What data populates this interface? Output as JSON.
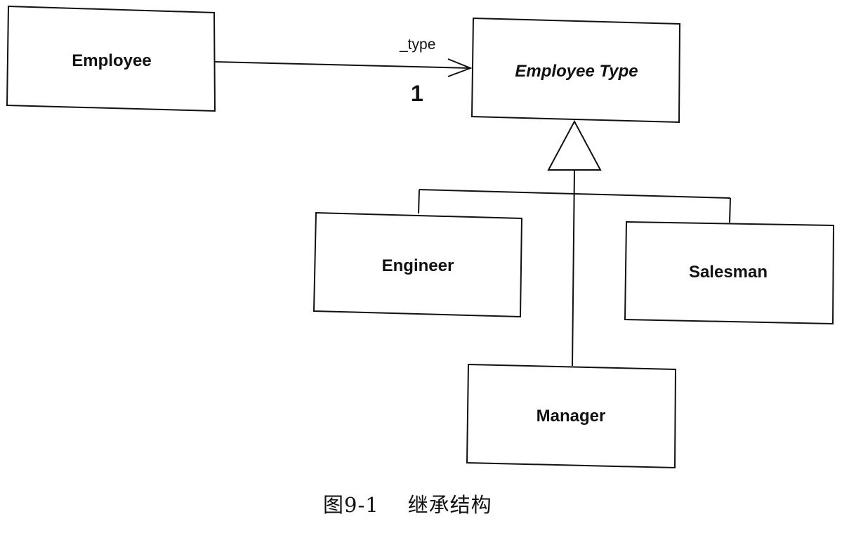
{
  "diagram": {
    "classes": {
      "employee": "Employee",
      "employee_type": "Employee Type",
      "engineer": "Engineer",
      "salesman": "Salesman",
      "manager": "Manager"
    },
    "association": {
      "role": "_type",
      "multiplicity": "1"
    },
    "caption": "图9-1    继承结构"
  }
}
